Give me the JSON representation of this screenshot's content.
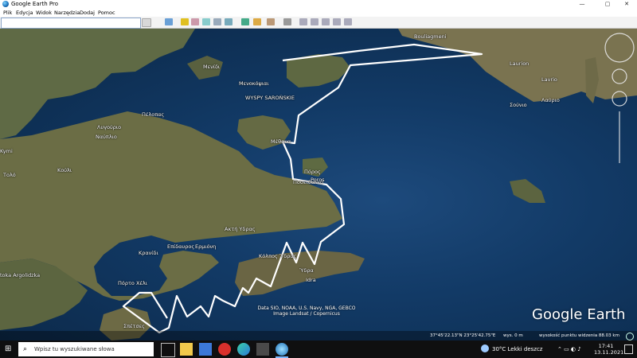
{
  "window": {
    "title": "Google Earth Pro",
    "minimize_glyph": "—",
    "maximize_glyph": "▢",
    "close_glyph": "✕"
  },
  "menu": {
    "items": [
      "Plik",
      "Edycja",
      "Widok",
      "Narzędzia",
      "Dodaj",
      "Pomoc"
    ]
  },
  "search": {
    "value": ""
  },
  "map": {
    "labels": [
      "Bouliagmeni",
      "Μενίδι",
      "Μενοκόψιαι",
      "WYSPY SAROŃSKIE",
      "Πέλοπας",
      "Μέθανα",
      "Πόρος",
      "Ποσειδώνιο",
      "Λυγούριο",
      "Ναύπλιο",
      "Τολό",
      "Kούλι",
      "Ακτή Υδρας",
      "Επίδαυρος",
      "Ερμιόνη",
      "Κρανίδι",
      "Πόρτο Χέλι",
      "Σπέτσες",
      "Ύδρα",
      "Idra",
      "Laurion",
      "Lavrio",
      "Λαύριο",
      "Σούνιο",
      "Kymi",
      "toka Argolidzka",
      "Poros",
      "Κόλπος Ύδρας"
    ],
    "ge_logo": "Google Earth",
    "attribution_line1": "Data SIO, NOAA, U.S. Navy, NGA, GEBCO",
    "attribution_line2": "Image Landsat / Copernicus"
  },
  "status": {
    "coords": "37°45'22.13\"N    23°25'42.75\"E",
    "altitude": "wys.      0 m",
    "eye": "wysokość punktu widzenia   88.03 km"
  },
  "taskbar": {
    "search_placeholder": "Wpisz tu wyszukiwane słowa",
    "weather": "30°C  Lekki deszcz",
    "time": "17:41",
    "date": "13.11.2021",
    "start_glyph": "⊞",
    "search_glyph": "⌕"
  }
}
